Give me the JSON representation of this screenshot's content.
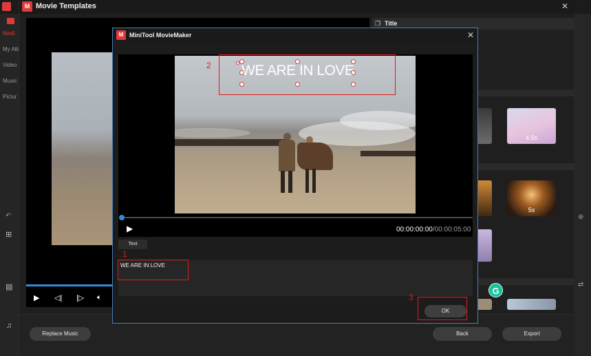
{
  "app": {
    "title": "Mi",
    "nav": [
      "Medi",
      "My Alb",
      "Video",
      "Music",
      "Pictur"
    ]
  },
  "movie_templates": {
    "title": "Movie Templates",
    "right_panel_title": "Title",
    "thumbnails": [
      {
        "label": "4.5s"
      },
      {
        "label": "5s"
      }
    ],
    "buttons": {
      "replace_music": "Replace Music",
      "back": "Back",
      "export": "Export"
    }
  },
  "dialog": {
    "title": "MiniTool MovieMaker",
    "overlay_title": "WE ARE IN LOVE",
    "time_current": "00:00:00:00",
    "time_total": "/00:00:05:00",
    "tab_label": "Text",
    "text_value": "WE ARE IN LOVE",
    "ok_label": "OK"
  },
  "annotations": [
    "1",
    "2",
    "3"
  ],
  "colors": {
    "accent_blue": "#2e8de0",
    "annotation_red": "#e01b1b",
    "logo_red": "#e03b3b"
  }
}
